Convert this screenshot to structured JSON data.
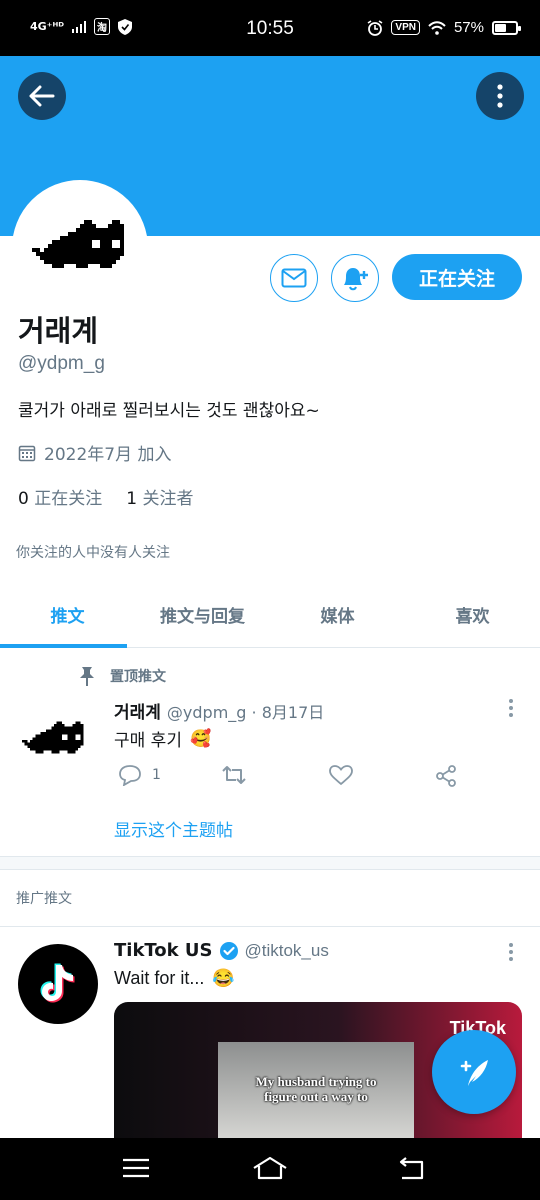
{
  "status_bar": {
    "network": "4G⁺ᴴᴰ",
    "app_badge": "淘",
    "time": "10:55",
    "vpn": "VPN",
    "battery": "57%",
    "battery_level": 0.57
  },
  "profile": {
    "display_name": "거래계",
    "handle": "@ydpm_g",
    "bio": "쿨거가 아래로 찔러보시는 것도 괜찮아요~",
    "joined": "2022年7月 加入",
    "following_count": "0",
    "following_label": "正在关注",
    "followers_count": "1",
    "followers_label": "关注者",
    "follow_button": "正在关注",
    "no_common_follows": "你关注的人中没有人关注"
  },
  "tabs": [
    {
      "label": "推文",
      "active": true
    },
    {
      "label": "推文与回复",
      "active": false
    },
    {
      "label": "媒体",
      "active": false
    },
    {
      "label": "喜欢",
      "active": false
    }
  ],
  "pinned_tweet": {
    "pinned_label": "置顶推文",
    "name": "거래계",
    "meta": "@ydpm_g · 8月17日",
    "text": "구매 후기",
    "emoji": "🥰",
    "reply_count": "1",
    "show_thread": "显示这个主题帖"
  },
  "promoted": {
    "label": "推广推文",
    "name": "TikTok US",
    "handle": "@tiktok_us",
    "text": "Wait for it...",
    "emoji": "😂",
    "media_logo": "TikTok",
    "media_caption_line1": "My husband trying to",
    "media_caption_line2": "figure out a way to"
  },
  "colors": {
    "accent": "#1da1f2",
    "banner": "#1da1f2",
    "circle_button": "#154469",
    "secondary_text": "#657786"
  }
}
